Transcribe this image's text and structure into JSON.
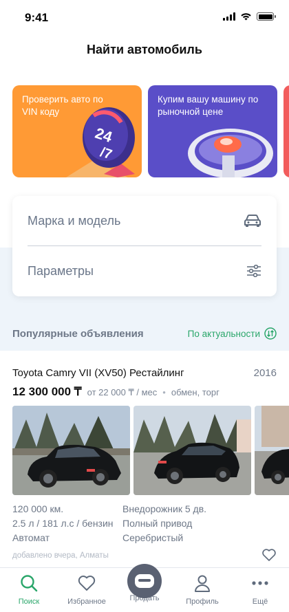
{
  "status_bar": {
    "time": "9:41"
  },
  "header": {
    "title": "Найти автомобиль"
  },
  "promos": [
    {
      "text": "Проверить авто по VIN коду",
      "badge": "24/7",
      "color": "#ff9a35"
    },
    {
      "text": "Купим вашу машину по рыночной цене",
      "color": "#5a4ec8"
    },
    {
      "color": "#f25c5c"
    }
  ],
  "search": {
    "make_model_label": "Марка и модель",
    "make_model_icon": "car-icon",
    "params_label": "Параметры",
    "params_icon": "sliders-icon"
  },
  "popular": {
    "title": "Популярные объявления",
    "sort_label": "По актуальности",
    "sort_icon": "sort-arrows-icon"
  },
  "listing": {
    "title": "Toyota Camry VII (XV50) Рестайлинг",
    "year": "2016",
    "price": "12 300 000 ₸",
    "credit": "от 22 000 ₸ / мес",
    "exchange": "обмен, торг",
    "specs_left": [
      "120 000 км.",
      "2.5 л / 181 л.с / бензин",
      "Автомат"
    ],
    "specs_right": [
      "Внедорожник 5 дв.",
      "Полный привод",
      "Серебристый"
    ],
    "added": "добавлено вчера, Алматы",
    "photo_count": 3
  },
  "tabbar": {
    "items": [
      {
        "label": "Поиск",
        "icon": "search-icon",
        "active": true
      },
      {
        "label": "Избранное",
        "icon": "heart-icon",
        "active": false
      },
      {
        "label": "Продать",
        "icon": "sell-icon",
        "active": false
      },
      {
        "label": "Профиль",
        "icon": "profile-icon",
        "active": false
      },
      {
        "label": "Ещё",
        "icon": "more-icon",
        "active": false
      }
    ]
  },
  "colors": {
    "accent": "#2aa66a",
    "text_muted": "#6d7787",
    "sell_button": "#5a6172"
  }
}
